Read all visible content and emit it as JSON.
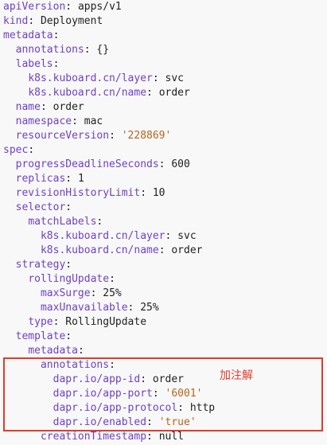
{
  "note": "加注解",
  "lines": [
    {
      "indent": 0,
      "key": "apiVersion",
      "value": "apps/v1"
    },
    {
      "indent": 0,
      "key": "kind",
      "value": "Deployment"
    },
    {
      "indent": 0,
      "key": "metadata",
      "value": ""
    },
    {
      "indent": 1,
      "key": "annotations",
      "value": "{}"
    },
    {
      "indent": 1,
      "key": "labels",
      "value": ""
    },
    {
      "indent": 2,
      "key": "k8s.kuboard.cn/layer",
      "value": "svc"
    },
    {
      "indent": 2,
      "key": "k8s.kuboard.cn/name",
      "value": "order"
    },
    {
      "indent": 1,
      "key": "name",
      "value": "order"
    },
    {
      "indent": 1,
      "key": "namespace",
      "value": "mac"
    },
    {
      "indent": 1,
      "key": "resourceVersion",
      "value": "'228869'",
      "quoted": true
    },
    {
      "indent": 0,
      "key": "spec",
      "value": ""
    },
    {
      "indent": 1,
      "key": "progressDeadlineSeconds",
      "value": "600"
    },
    {
      "indent": 1,
      "key": "replicas",
      "value": "1"
    },
    {
      "indent": 1,
      "key": "revisionHistoryLimit",
      "value": "10"
    },
    {
      "indent": 1,
      "key": "selector",
      "value": ""
    },
    {
      "indent": 2,
      "key": "matchLabels",
      "value": ""
    },
    {
      "indent": 3,
      "key": "k8s.kuboard.cn/layer",
      "value": "svc"
    },
    {
      "indent": 3,
      "key": "k8s.kuboard.cn/name",
      "value": "order"
    },
    {
      "indent": 1,
      "key": "strategy",
      "value": ""
    },
    {
      "indent": 2,
      "key": "rollingUpdate",
      "value": ""
    },
    {
      "indent": 3,
      "key": "maxSurge",
      "value": "25%"
    },
    {
      "indent": 3,
      "key": "maxUnavailable",
      "value": "25%"
    },
    {
      "indent": 2,
      "key": "type",
      "value": "RollingUpdate"
    },
    {
      "indent": 1,
      "key": "template",
      "value": ""
    },
    {
      "indent": 2,
      "key": "metadata",
      "value": ""
    },
    {
      "indent": 3,
      "key": "annotations",
      "value": ""
    },
    {
      "indent": 4,
      "key": "dapr.io/app-id",
      "value": "order"
    },
    {
      "indent": 4,
      "key": "dapr.io/app-port",
      "value": "'6001'",
      "quoted": true
    },
    {
      "indent": 4,
      "key": "dapr.io/app-protocol",
      "value": "http"
    },
    {
      "indent": 4,
      "key": "dapr.io/enabled",
      "value": "'true'",
      "quoted": true
    },
    {
      "indent": 3,
      "key": "creationTimestamp",
      "value": "null"
    }
  ]
}
